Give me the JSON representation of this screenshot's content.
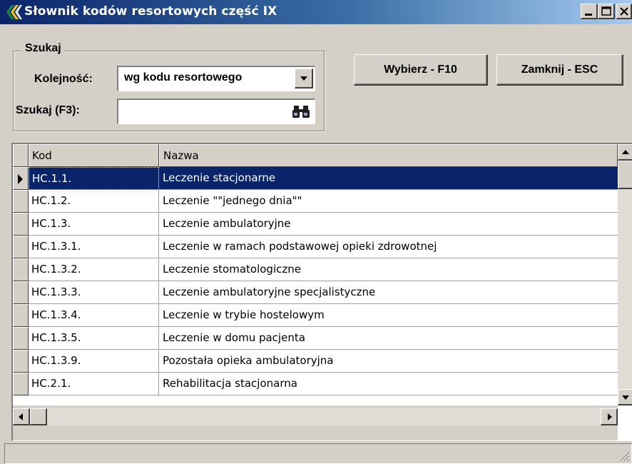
{
  "window": {
    "title": "Słownik kodów resortowych część IX"
  },
  "search": {
    "group_label": "Szukaj",
    "order_label": "Kolejność:",
    "order_value": "wg kodu resortowego",
    "search_label": "Szukaj (F3):",
    "search_value": ""
  },
  "actions": {
    "select_label": "Wybierz - F10",
    "close_label": "Zamknij - ESC"
  },
  "grid": {
    "columns": [
      "Kod",
      "Nazwa"
    ],
    "selected_index": 0,
    "rows": [
      {
        "code": "HC.1.1.",
        "name": "Leczenie stacjonarne"
      },
      {
        "code": "HC.1.2.",
        "name": "Leczenie \"\"jednego dnia\"\""
      },
      {
        "code": "HC.1.3.",
        "name": "Leczenie ambulatoryjne"
      },
      {
        "code": "HC.1.3.1.",
        "name": "Leczenie w ramach podstawowej opieki zdrowotnej"
      },
      {
        "code": "HC.1.3.2.",
        "name": "Leczenie stomatologiczne"
      },
      {
        "code": "HC.1.3.3.",
        "name": "Leczenie ambulatoryjne specjalistyczne"
      },
      {
        "code": "HC.1.3.4.",
        "name": "Leczenie w trybie hostelowym"
      },
      {
        "code": "HC.1.3.5.",
        "name": "Leczenie w domu pacjenta"
      },
      {
        "code": "HC.1.3.9.",
        "name": "Pozostała opieka ambulatoryjna"
      },
      {
        "code": "HC.2.1.",
        "name": "Rehabilitacja stacjonarna"
      }
    ]
  },
  "colors": {
    "face": "#d4d0c8",
    "title_start": "#0a246a",
    "title_end": "#a6caf0",
    "selection": "#0a246a"
  },
  "icons": {
    "app": "app-logo-icon",
    "minimize": "minimize-icon",
    "maximize": "maximize-icon",
    "close": "close-icon",
    "dropdown": "dropdown-arrow-icon",
    "find": "binoculars-icon"
  }
}
